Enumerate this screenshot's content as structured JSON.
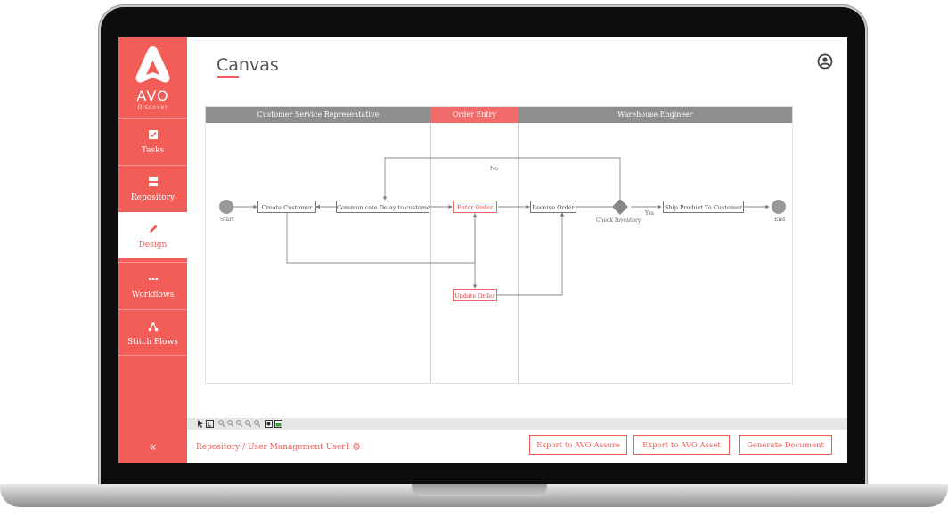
{
  "brand": {
    "name": "AVO",
    "sub": "Discover"
  },
  "sidebar": {
    "items": [
      {
        "label": "Tasks",
        "icon": "checkbox-icon"
      },
      {
        "label": "Repository",
        "icon": "repository-icon"
      },
      {
        "label": "Design",
        "icon": "pencil-icon"
      },
      {
        "label": "Workflows",
        "icon": "dots-icon"
      },
      {
        "label": "Stitch Flows",
        "icon": "stitch-icon"
      }
    ],
    "active": "Design",
    "collapse": "«"
  },
  "header": {
    "title": "Canvas"
  },
  "lanes": [
    {
      "label": "Customer Service Representative"
    },
    {
      "label": "Order Entry"
    },
    {
      "label": "Warehouse Engineer"
    }
  ],
  "flow": {
    "start": "Start",
    "end": "End",
    "create_customer": "Create Customer",
    "communicate": "Communicate  Delay to customer",
    "enter_order": "Enter Order",
    "update_order": "Update Order",
    "receive_order": "Receive Order",
    "check_inventory": "Check Inventory",
    "ship_product": "Ship Product To Customer",
    "label_no": "No",
    "label_yes": "Yes"
  },
  "footer": {
    "breadcrumb": "Repository / User Management User1",
    "buttons": [
      "Export to AVO Assure",
      "Export to AVO Asset",
      "Generate Document"
    ]
  },
  "colors": {
    "accent": "#f25d58",
    "lane_gray": "#8e8e8e",
    "lane_active": "#f26b6b"
  }
}
